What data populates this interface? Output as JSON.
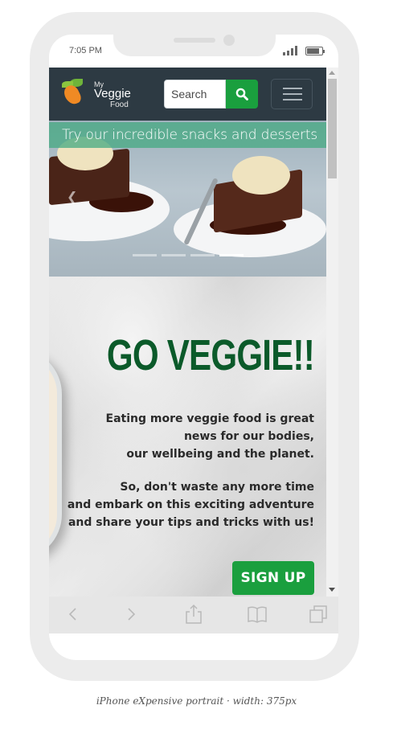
{
  "device": {
    "status_time": "7:05 PM",
    "caption": "iPhone eXpensive portrait · width: 375px"
  },
  "navbar": {
    "logo": {
      "line1": "My",
      "line2": "Veggie",
      "line3": "Food"
    },
    "search": {
      "value": "Search",
      "button_icon": "search-icon"
    },
    "menu_icon": "hamburger-menu-icon"
  },
  "carousel": {
    "caption": "Try our incredible snacks and desserts",
    "slide_count": 4,
    "active_slide": 4
  },
  "hero": {
    "title": "GO VEGGIE!!",
    "paragraph1": [
      "Eating more veggie food is great",
      "news for our bodies,",
      "our wellbeing and the planet."
    ],
    "paragraph2": [
      "So, don't waste any more time",
      "and embark on this exciting adventure",
      "and share your tips and tricks with us!"
    ],
    "signup_label": "SIGN UP"
  },
  "colors": {
    "navbar_bg": "#2d3a43",
    "accent_green": "#1a9f3e",
    "title_green": "#0b5a2a",
    "caption_bg": "#46aa82"
  },
  "browser_toolbar": [
    "back-icon",
    "forward-icon",
    "share-icon",
    "bookmarks-icon",
    "tabs-icon"
  ]
}
